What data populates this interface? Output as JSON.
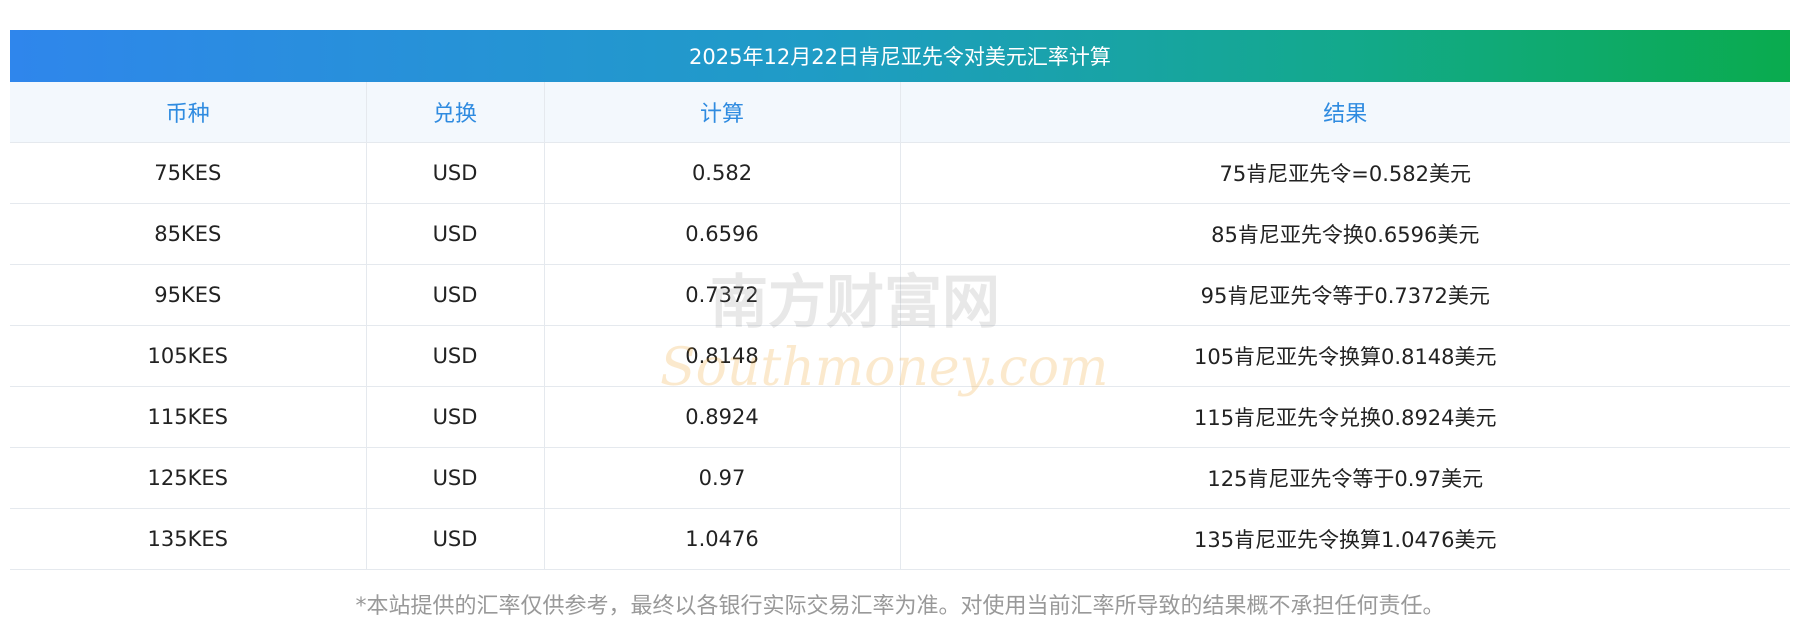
{
  "title": "2025年12月22日肯尼亚先令对美元汇率计算",
  "table": {
    "headers": [
      "币种",
      "兑换",
      "计算",
      "结果"
    ],
    "rows": [
      [
        "75KES",
        "USD",
        "0.582",
        "75肯尼亚先令=0.582美元"
      ],
      [
        "85KES",
        "USD",
        "0.6596",
        "85肯尼亚先令换0.6596美元"
      ],
      [
        "95KES",
        "USD",
        "0.7372",
        "95肯尼亚先令等于0.7372美元"
      ],
      [
        "105KES",
        "USD",
        "0.8148",
        "105肯尼亚先令换算0.8148美元"
      ],
      [
        "115KES",
        "USD",
        "0.8924",
        "115肯尼亚先令兑换0.8924美元"
      ],
      [
        "125KES",
        "USD",
        "0.97",
        "125肯尼亚先令等于0.97美元"
      ],
      [
        "135KES",
        "USD",
        "1.0476",
        "135肯尼亚先令换算1.0476美元"
      ]
    ]
  },
  "watermark": {
    "cn": "南方财富网",
    "en": "Southmoney.com",
    "color": "#f0a020"
  },
  "footnote": "*本站提供的汇率仅供参考，最终以各银行实际交易汇率为准。对使用当前汇率所导致的结果概不承担任何责任。"
}
